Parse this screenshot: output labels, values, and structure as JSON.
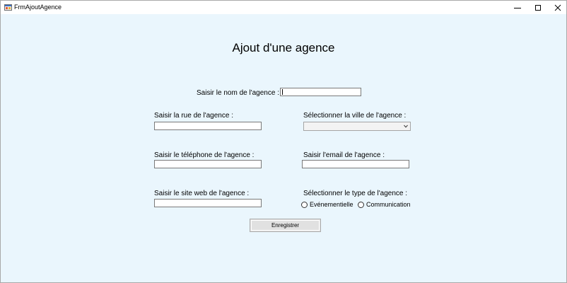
{
  "window": {
    "title": "FrmAjoutAgence",
    "controls": {
      "minimize": "minimize",
      "maximize": "maximize",
      "close": "close"
    }
  },
  "form": {
    "heading": "Ajout d'une agence",
    "nom": {
      "label": "Saisir le nom de l'agence :",
      "value": ""
    },
    "rue": {
      "label": "Saisir la rue de l'agence :",
      "value": ""
    },
    "ville": {
      "label": "Sélectionner la ville de l'agence :",
      "selected": ""
    },
    "telephone": {
      "label": "Saisir le téléphone de l'agence :",
      "value": ""
    },
    "email": {
      "label": "Saisir l'email de l'agence :",
      "value": ""
    },
    "site_web": {
      "label": "Saisir le site web de l'agence :",
      "value": ""
    },
    "type": {
      "label": "Sélectionner le type de l'agence :",
      "options": [
        "Evénementielle",
        "Communication"
      ],
      "selected": null
    },
    "submit_label": "Enregistrer"
  },
  "colors": {
    "form_background": "#eaf6fd",
    "titlebar": "#ffffff",
    "button_face": "#e1e1e1"
  },
  "icons": [
    "app-icon",
    "minimize-icon",
    "maximize-icon",
    "close-icon",
    "chevron-down-icon"
  ]
}
